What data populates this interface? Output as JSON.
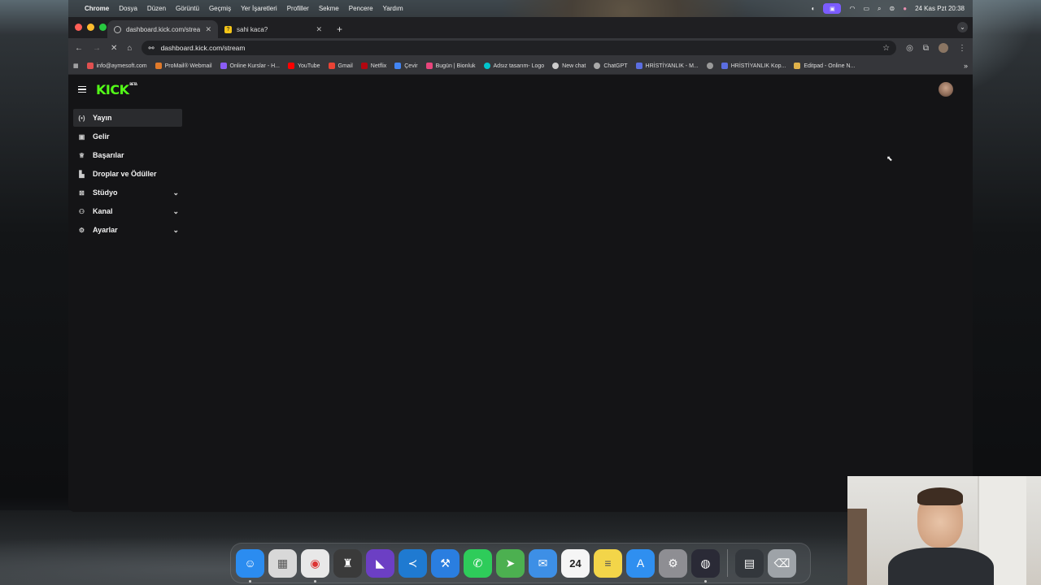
{
  "menubar": {
    "app": "Chrome",
    "items": [
      "Dosya",
      "Düzen",
      "Görüntü",
      "Geçmiş",
      "Yer İşaretleri",
      "Profiller",
      "Sekme",
      "Pencere",
      "Yardım"
    ],
    "datetime": "24 Kas Pzt  20:38"
  },
  "tabs": [
    {
      "title": "dashboard.kick.com/stream",
      "favicon_icon": "chrome-tab-icon"
    },
    {
      "title": "sahi kaca?",
      "favicon_icon": "question-icon"
    }
  ],
  "toolbar": {
    "url": "dashboard.kick.com/stream"
  },
  "bookmarks": [
    {
      "label": "info@aymesoft.com",
      "color": "#e05050"
    },
    {
      "label": "ProMail® Webmail",
      "color": "#e07a2a"
    },
    {
      "label": "Online Kurslar - H...",
      "color": "#8b5cf6"
    },
    {
      "label": "YouTube",
      "color": "#ff0000"
    },
    {
      "label": "Gmail",
      "color": "#ea4335"
    },
    {
      "label": "Netflix",
      "color": "#b20710"
    },
    {
      "label": "Çevir",
      "color": "#4285f4"
    },
    {
      "label": "Bugün | Bionluk",
      "color": "#e8457c"
    },
    {
      "label": "Adsız tasarım- Logo",
      "color": "#00c4cc"
    },
    {
      "label": "New chat",
      "color": "#cccccc"
    },
    {
      "label": "ChatGPT",
      "color": "#aaaaaa"
    },
    {
      "label": "HRİSTİYANLIK - M...",
      "color": "#5b6ee1"
    },
    {
      "label": "",
      "color": "#9a9a9a"
    },
    {
      "label": "HRİSTİYANLIK Kop...",
      "color": "#5b6ee1"
    },
    {
      "label": "Editpad - Online N...",
      "color": "#e0b24a"
    }
  ],
  "page": {
    "logo": "KICK",
    "logo_badge": "BETA",
    "sidebar": [
      {
        "label": "Yayın",
        "icon": "broadcast-icon",
        "active": true,
        "expandable": false
      },
      {
        "label": "Gelir",
        "icon": "revenue-icon",
        "active": false,
        "expandable": false
      },
      {
        "label": "Başarılar",
        "icon": "trophy-icon",
        "active": false,
        "expandable": false
      },
      {
        "label": "Droplar ve Ödüller",
        "icon": "gift-icon",
        "active": false,
        "expandable": false
      },
      {
        "label": "Stüdyo",
        "icon": "studio-icon",
        "active": false,
        "expandable": true
      },
      {
        "label": "Kanal",
        "icon": "channel-icon",
        "active": false,
        "expandable": true
      },
      {
        "label": "Ayarlar",
        "icon": "gear-icon",
        "active": false,
        "expandable": true
      }
    ]
  },
  "dock": {
    "apps": [
      {
        "name": "finder",
        "color": "#2b8cf0",
        "glyph": "☺"
      },
      {
        "name": "launchpad",
        "color": "#d8d8d8",
        "glyph": "▦"
      },
      {
        "name": "chrome",
        "color": "#e8e8e8",
        "glyph": "◉"
      },
      {
        "name": "tower",
        "color": "#3a3a3a",
        "glyph": "♜"
      },
      {
        "name": "visual-studio",
        "color": "#6c3fc4",
        "glyph": "◣"
      },
      {
        "name": "vscode",
        "color": "#1f7ad1",
        "glyph": "≺"
      },
      {
        "name": "xcode",
        "color": "#2a7ee0",
        "glyph": "⚒"
      },
      {
        "name": "whatsapp",
        "color": "#2ecc5a",
        "glyph": "✆"
      },
      {
        "name": "maps",
        "color": "#4cb050",
        "glyph": "➤"
      },
      {
        "name": "mail",
        "color": "#3d8fe6",
        "glyph": "✉"
      },
      {
        "name": "calendar",
        "color": "#f5f5f5",
        "glyph": "24"
      },
      {
        "name": "notes",
        "color": "#f3d549",
        "glyph": "≡"
      },
      {
        "name": "app-store",
        "color": "#2f8ff0",
        "glyph": "A"
      },
      {
        "name": "system-settings",
        "color": "#8e8e93",
        "glyph": "⚙"
      },
      {
        "name": "obs",
        "color": "#2a2a36",
        "glyph": "◍"
      },
      {
        "name": "downloads",
        "color": "#33373c",
        "glyph": "▤"
      },
      {
        "name": "trash",
        "color": "#9ea3a8",
        "glyph": "🗑"
      }
    ]
  }
}
